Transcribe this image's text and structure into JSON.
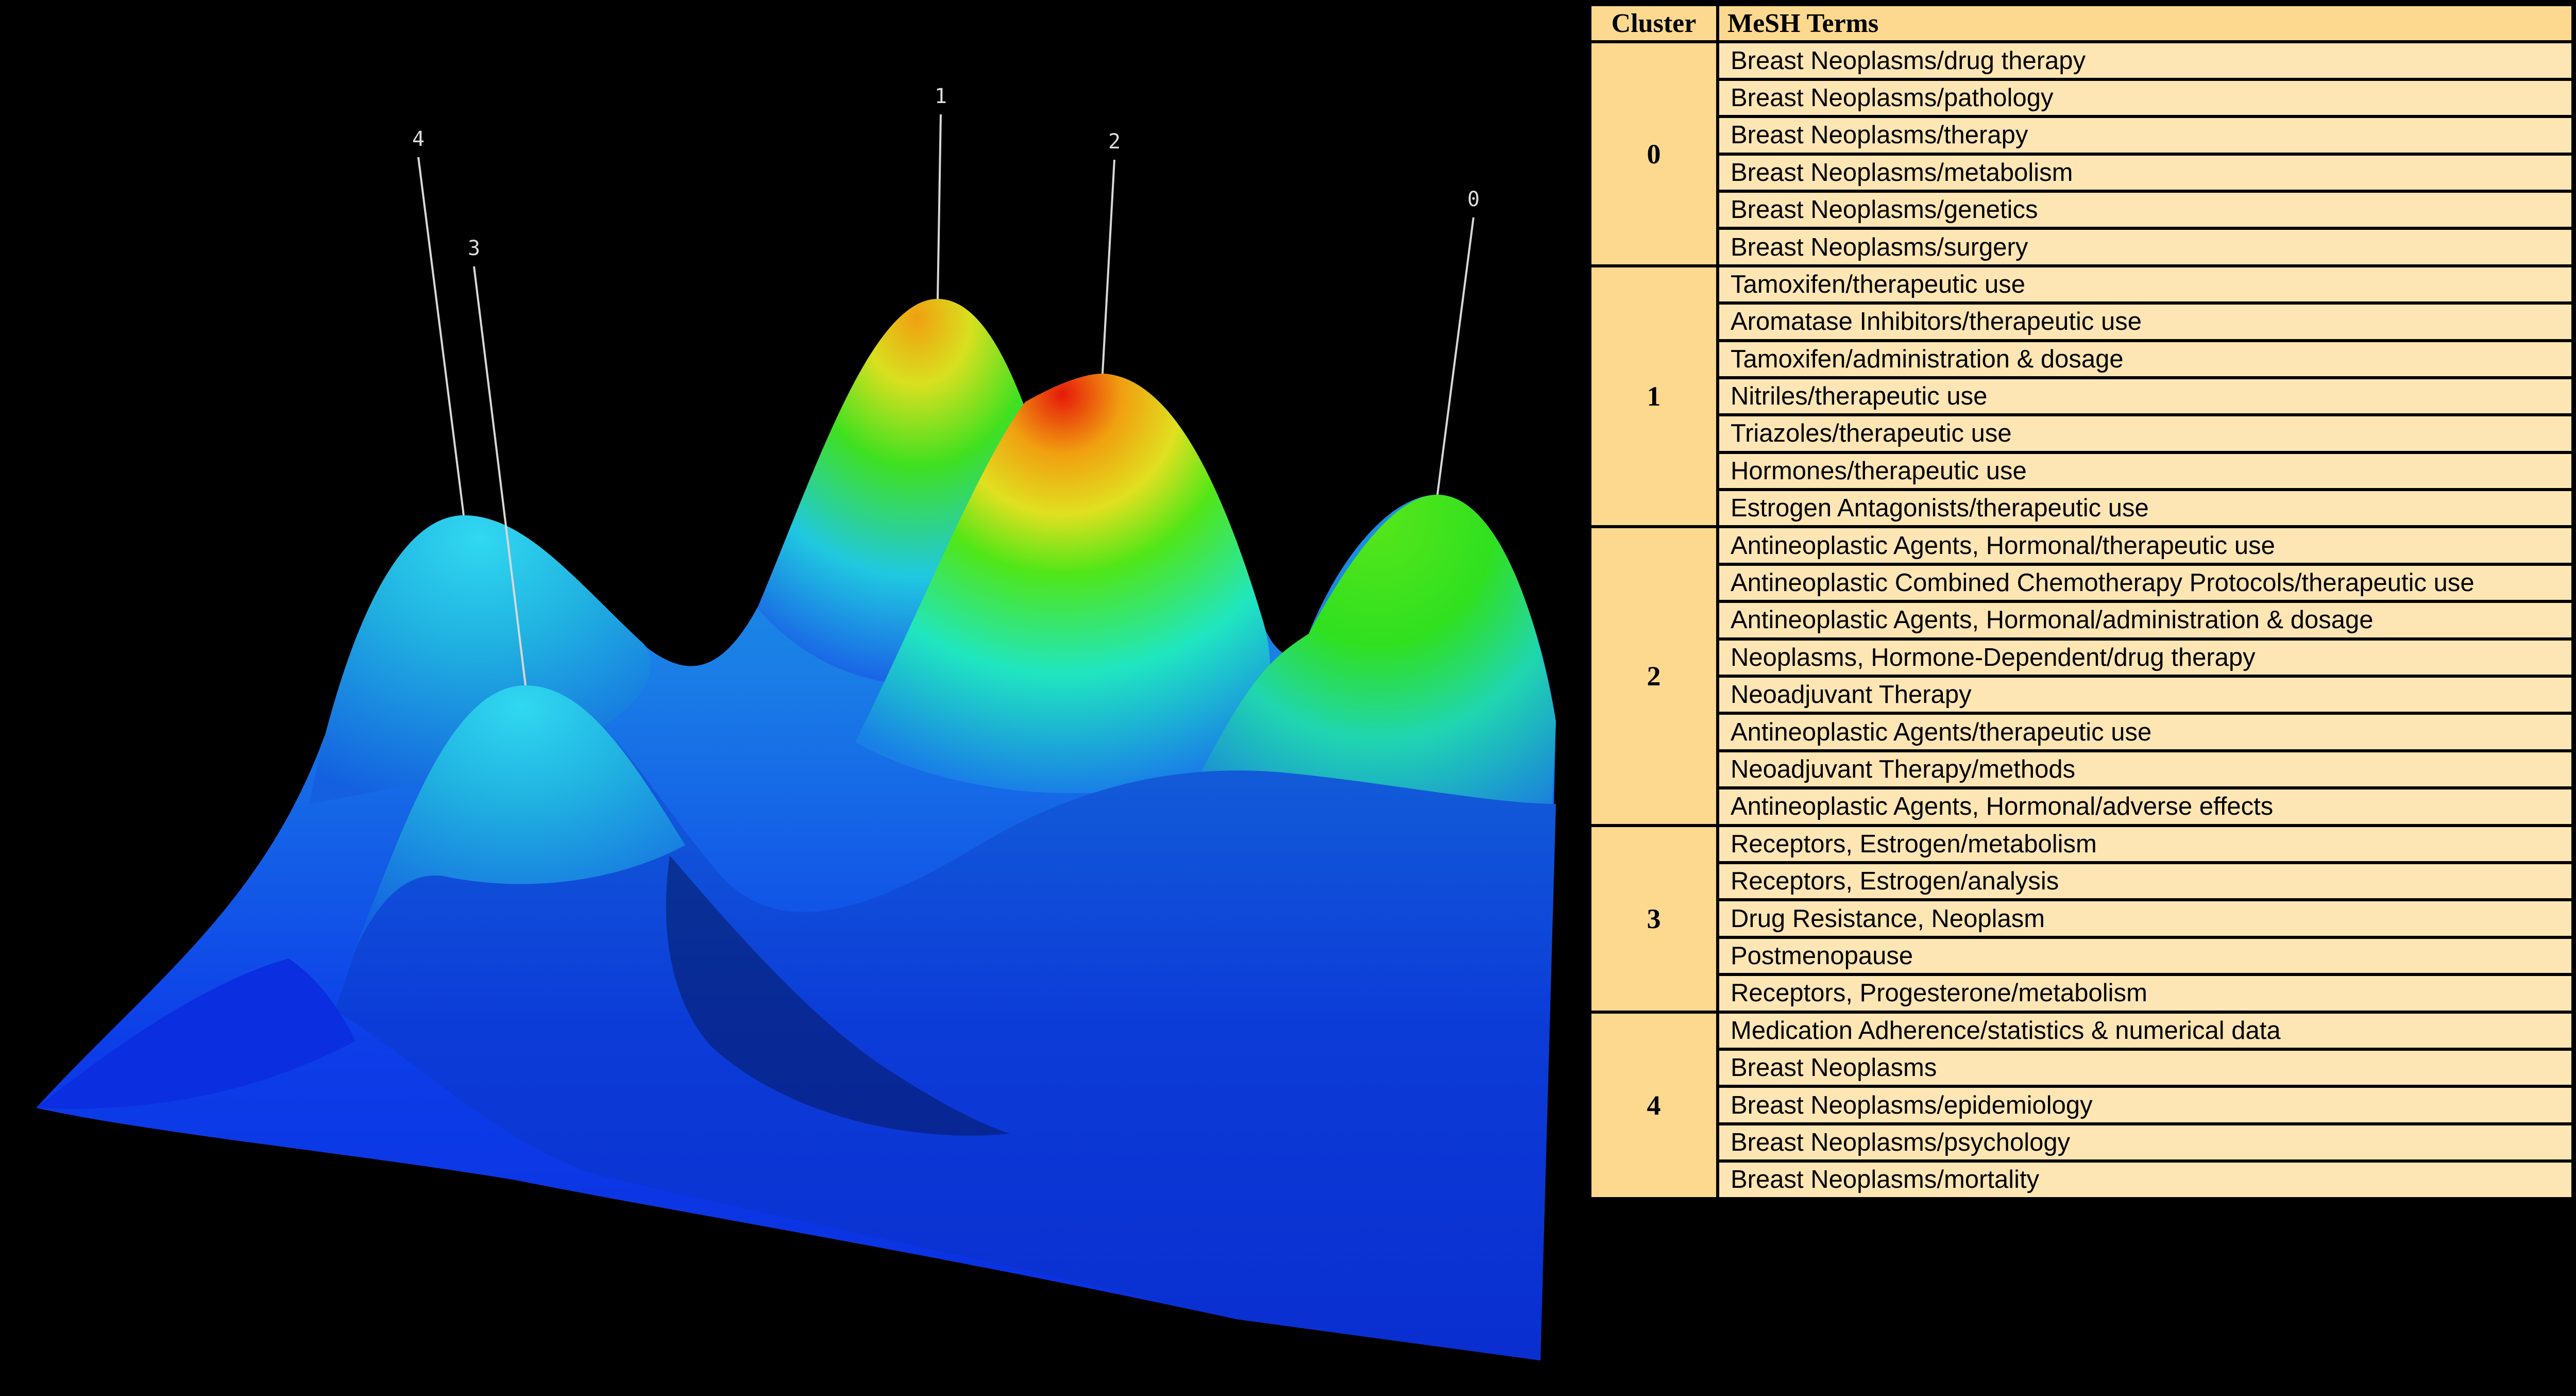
{
  "chart_data": {
    "type": "surface-3d",
    "peaks": [
      {
        "label": "0"
      },
      {
        "label": "1"
      },
      {
        "label": "2"
      },
      {
        "label": "3"
      },
      {
        "label": "4"
      }
    ],
    "colors": {
      "low": "#0a2ee8",
      "mid_low": "#1fb9e0",
      "mid": "#2ef0e0",
      "green": "#3ee61a",
      "yellow": "#e8d21a",
      "high": "#e8200a",
      "background": "#000000"
    }
  },
  "table": {
    "header_cluster": "Cluster",
    "header_terms": "MeSH Terms",
    "colors": {
      "cell": "#fde6b3",
      "header": "#fdd98f",
      "border": "#000000"
    },
    "clusters": [
      {
        "id": "0",
        "terms": [
          "Breast Neoplasms/drug therapy",
          "Breast Neoplasms/pathology",
          "Breast Neoplasms/therapy",
          "Breast Neoplasms/metabolism",
          "Breast Neoplasms/genetics",
          "Breast Neoplasms/surgery"
        ]
      },
      {
        "id": "1",
        "terms": [
          "Tamoxifen/therapeutic use",
          "Aromatase Inhibitors/therapeutic use",
          "Tamoxifen/administration & dosage",
          "Nitriles/therapeutic use",
          "Triazoles/therapeutic use",
          "Hormones/therapeutic use",
          "Estrogen Antagonists/therapeutic use"
        ]
      },
      {
        "id": "2",
        "terms": [
          "Antineoplastic Agents, Hormonal/therapeutic use",
          "Antineoplastic Combined Chemotherapy Protocols/therapeutic use",
          "Antineoplastic Agents, Hormonal/administration & dosage",
          "Neoplasms, Hormone-Dependent/drug therapy",
          "Neoadjuvant Therapy",
          "Antineoplastic Agents/therapeutic use",
          "Neoadjuvant Therapy/methods",
          "Antineoplastic Agents, Hormonal/adverse effects"
        ]
      },
      {
        "id": "3",
        "terms": [
          "Receptors, Estrogen/metabolism",
          "Receptors, Estrogen/analysis",
          "Drug Resistance, Neoplasm",
          "Postmenopause",
          "Receptors, Progesterone/metabolism"
        ]
      },
      {
        "id": "4",
        "terms": [
          "Medication Adherence/statistics & numerical data",
          "Breast Neoplasms",
          "Breast Neoplasms/epidemiology",
          "Breast Neoplasms/psychology",
          "Breast Neoplasms/mortality"
        ]
      }
    ]
  }
}
